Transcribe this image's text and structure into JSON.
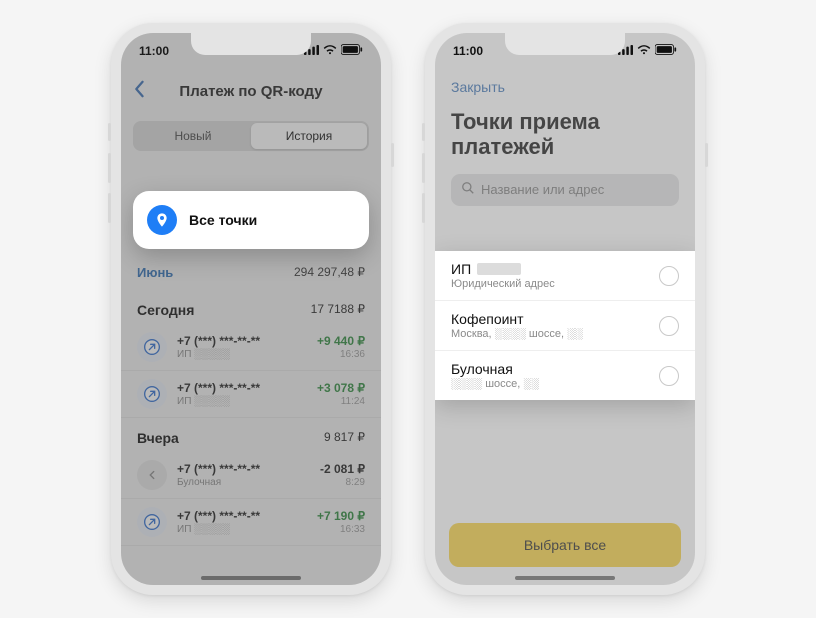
{
  "status": {
    "time": "11:00"
  },
  "left": {
    "title": "Платеж по QR-коду",
    "tabs": {
      "new": "Новый",
      "history": "История"
    },
    "all_points": "Все точки",
    "month": {
      "name": "Июнь",
      "total": "294 297,48 ₽"
    },
    "sections": [
      {
        "title": "Сегодня",
        "total": "17 7188 ₽",
        "txs": [
          {
            "phone": "+7 (***) ***-**-**",
            "sub": "ИП ░░░░░",
            "amount": "+9 440 ₽",
            "time": "16:36",
            "positive": true,
            "icon": "in"
          },
          {
            "phone": "+7 (***) ***-**-**",
            "sub": "ИП ░░░░░",
            "amount": "+3 078 ₽",
            "time": "11:24",
            "positive": true,
            "icon": "in"
          }
        ]
      },
      {
        "title": "Вчера",
        "total": "9 817 ₽",
        "txs": [
          {
            "phone": "+7 (***) ***-**-**",
            "sub": "Булочная",
            "amount": "-2 081 ₽",
            "time": "8:29",
            "positive": false,
            "icon": "back"
          },
          {
            "phone": "+7 (***) ***-**-**",
            "sub": "ИП ░░░░░",
            "amount": "+7 190 ₽",
            "time": "16:33",
            "positive": true,
            "icon": "in"
          }
        ]
      }
    ]
  },
  "right": {
    "close": "Закрыть",
    "title": "Точки приема платежей",
    "search_placeholder": "Название или адрес",
    "options": [
      {
        "name": "ИП",
        "sub": "Юридический адрес"
      },
      {
        "name": "Кофепоинт",
        "sub": "Москва, ░░░░ шоссе, ░░"
      },
      {
        "name": "Булочная",
        "sub": "░░░░ шоссе, ░░"
      }
    ],
    "button": "Выбрать все"
  }
}
